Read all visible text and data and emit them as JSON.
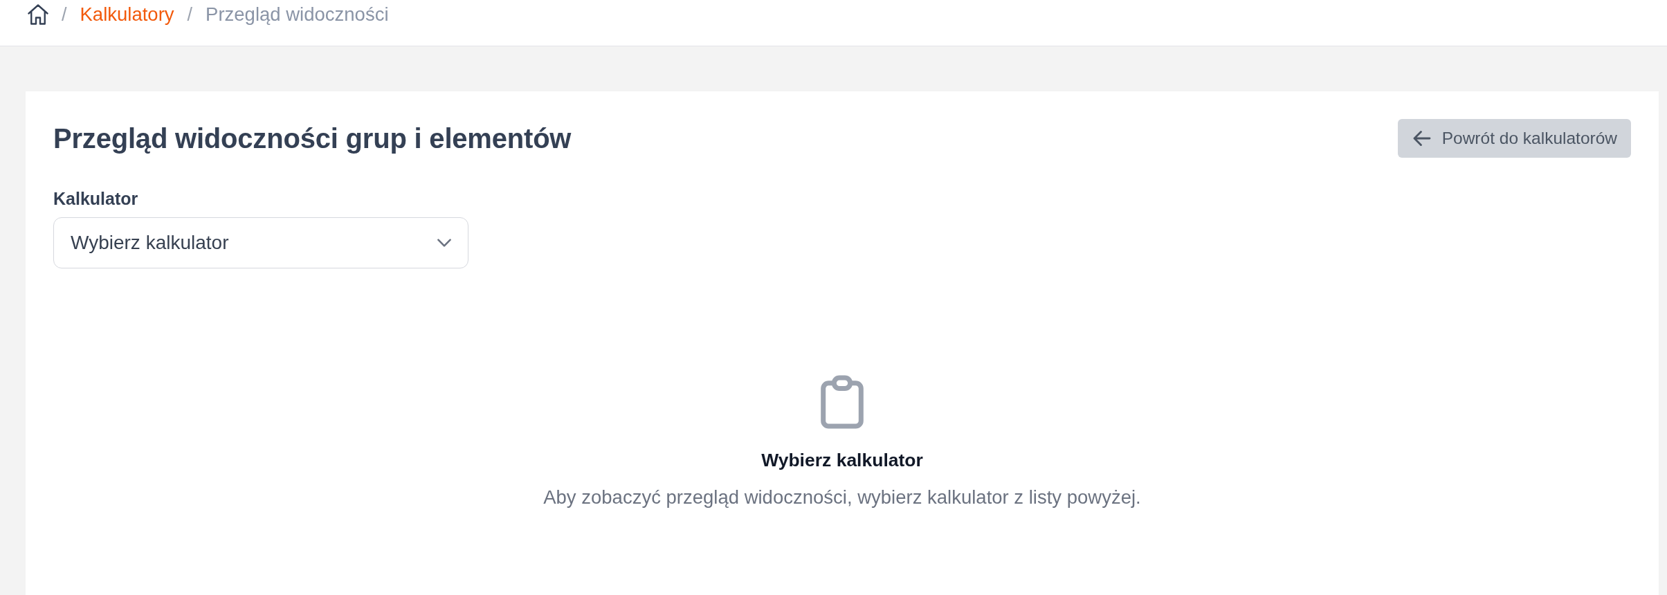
{
  "breadcrumb": {
    "items": [
      {
        "separator": "/",
        "label": "Kalkulatory",
        "kind": "link"
      },
      {
        "separator": "/",
        "label": "Przegląd widoczności",
        "kind": "current"
      }
    ]
  },
  "page": {
    "title": "Przegląd widoczności grup i elementów",
    "back_button": "Powrót do kalkulatorów"
  },
  "calculator_select": {
    "label": "Kalkulator",
    "value": "Wybierz kalkulator"
  },
  "empty_state": {
    "title": "Wybierz kalkulator",
    "message": "Aby zobaczyć przegląd widoczności, wybierz kalkulator z listy powyżej."
  }
}
